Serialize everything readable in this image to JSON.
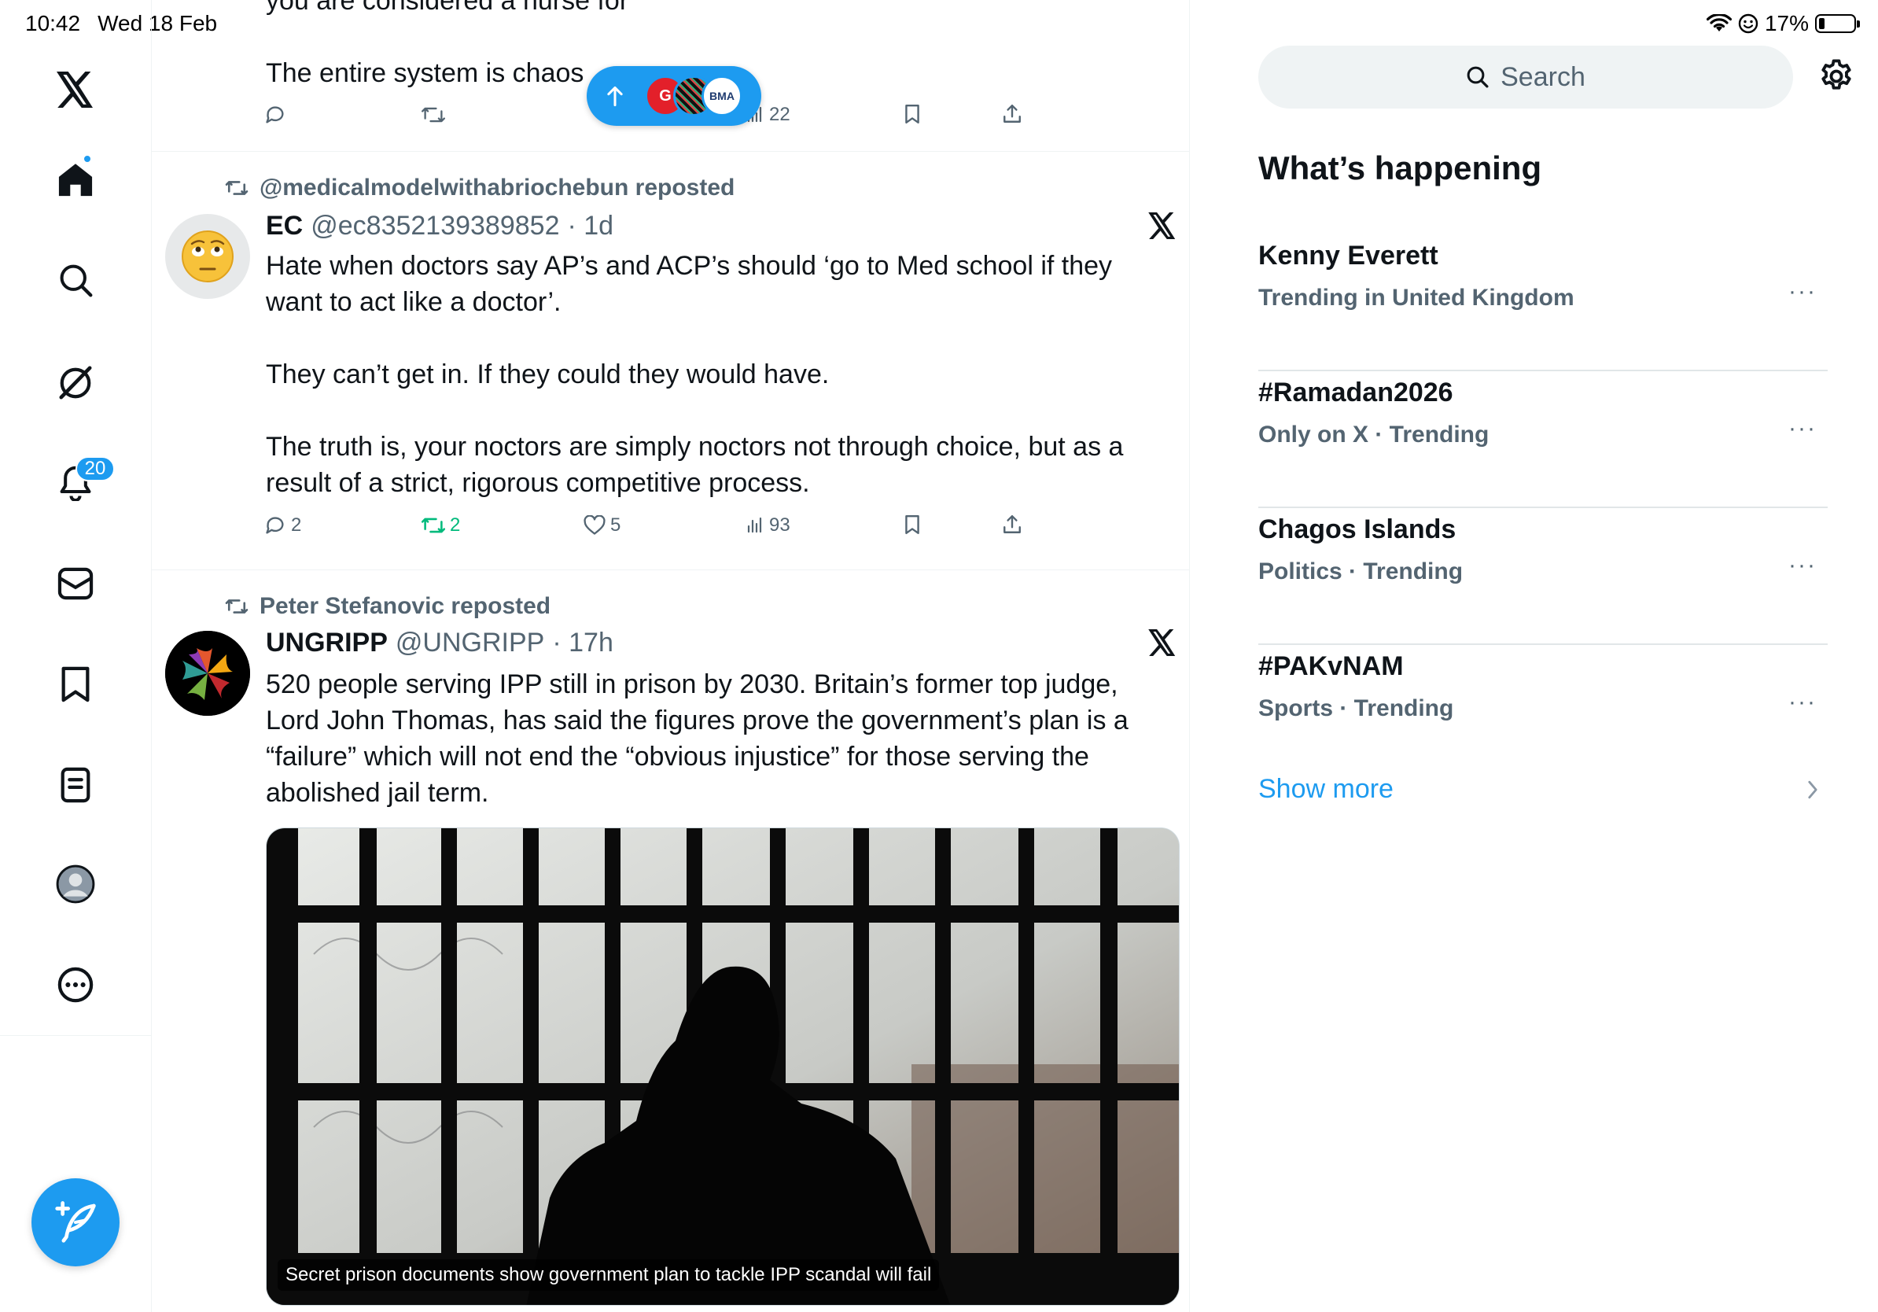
{
  "status_bar": {
    "time": "10:42",
    "date": "Wed 18 Feb",
    "battery": "17%",
    "battery_level": 0.17
  },
  "nav": {
    "items": [
      {
        "name": "x-logo-icon"
      },
      {
        "name": "home-icon",
        "active": true
      },
      {
        "name": "search-icon"
      },
      {
        "name": "grok-icon"
      },
      {
        "name": "notifications-icon"
      },
      {
        "name": "messages-icon"
      },
      {
        "name": "bookmarks-icon"
      },
      {
        "name": "lists-icon"
      },
      {
        "name": "profile-icon"
      },
      {
        "name": "more-icon"
      }
    ],
    "notification_badge": "20",
    "compose_icon": "compose-post-icon"
  },
  "feed": {
    "new_posts_pill": {
      "icon": "arrow-up-icon",
      "avatars": [
        "G",
        "",
        "BMA"
      ]
    },
    "top_tweet": {
      "text_partial": "you are considered a nurse for",
      "text_last": "The entire system is chaos",
      "views": "22"
    },
    "tweets": [
      {
        "repost_by": "@medicalmodelwithabriochebun reposted",
        "author_name": "EC",
        "handle": "@ec8352139389852",
        "time": "· 1d",
        "lines": [
          "Hate when doctors say AP’s and ACP’s should ‘go to Med school if they",
          "want to act like a doctor’.",
          "They can’t get in. If they could they would have.",
          "The truth is, your noctors are simply noctors not through choice, but as a",
          "result of a strict, rigorous competitive process."
        ],
        "replies": "2",
        "reposts": "2",
        "likes": "5",
        "views": "93"
      },
      {
        "repost_by": "Peter Stefanovic reposted",
        "author_name": "UNGRIPP",
        "handle": "@UNGRIPP",
        "time": "· 17h",
        "lines": [
          "520 people serving IPP still in prison by 2030. Britain’s  former top judge,",
          "Lord John Thomas, has said the figures prove the government’s plan is a",
          "“failure” which will not end the “obvious injustice” for those serving the",
          "abolished jail term."
        ],
        "media_caption": "Secret prison documents show government plan to tackle IPP scandal will fail"
      }
    ]
  },
  "sidebar": {
    "search_placeholder": "Search",
    "title": "What’s happening",
    "trends": [
      {
        "name": "Kenny Everett",
        "meta": "Trending in United Kingdom"
      },
      {
        "name": "#Ramadan2026",
        "meta": "Only on X · Trending"
      },
      {
        "name": "Chagos Islands",
        "meta": "Politics · Trending"
      },
      {
        "name": "#PAKvNAM",
        "meta": "Sports · Trending"
      }
    ],
    "trend_more": "···",
    "show_more": "Show more"
  },
  "colors": {
    "accent": "#1d9bf0",
    "text": "#0f1419",
    "secondary": "#536471",
    "repost_green": "#00ba7c",
    "border": "#eff3f4"
  }
}
